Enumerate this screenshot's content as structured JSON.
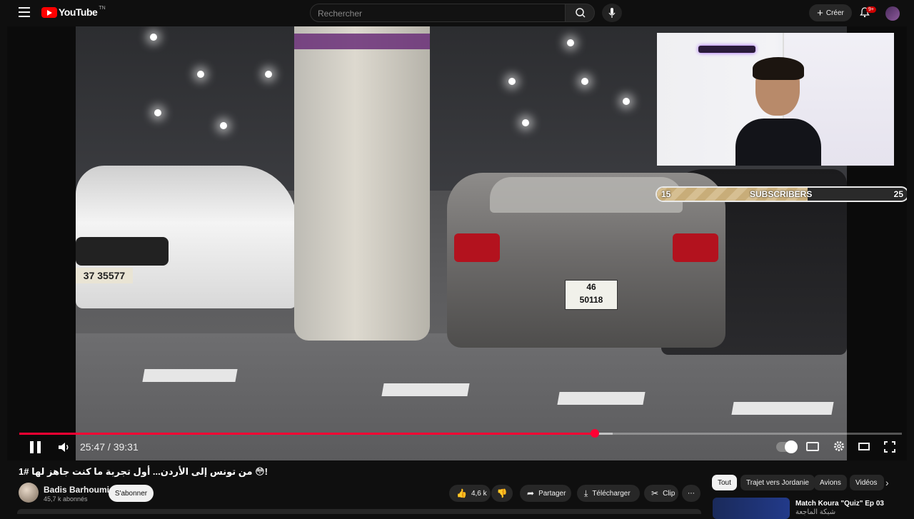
{
  "header": {
    "logo_text": "YouTube",
    "logo_country": "TN",
    "search_placeholder": "Rechercher",
    "create_label": "Créer",
    "notifications_badge": "9+"
  },
  "player": {
    "current_time": "25:47",
    "duration": "39:31",
    "time_display": "25:47 / 39:31",
    "progress_played_fraction": 0.652,
    "progress_loaded_fraction": 0.672,
    "overlay": {
      "subscribers_current": "15",
      "subscribers_label": "SUBSCRIBERS",
      "subscribers_goal": "25",
      "goal_fill_fraction": 0.6
    },
    "scene": {
      "plate_white": "37 35577",
      "plate_grey_top": "46",
      "plate_grey_bottom": "50118"
    }
  },
  "video": {
    "title": "من تونس إلى الأردن... أول تجربة ما كنت جاهز لها #1 😳!",
    "channel_name": "Badis Barhoumi",
    "channel_subscribers": "45,7 k abonnés",
    "subscribe_label": "S'abonner",
    "likes": "4,6 k",
    "share_label": "Partager",
    "download_label": "Télécharger",
    "clip_label": "Clip",
    "more_label": "⋯"
  },
  "chips": [
    "Tout",
    "Trajet vers Jordanie",
    "Avions",
    "Vidéos"
  ],
  "recommendation": {
    "title": "Match Koura \"Quiz\" Ep 03",
    "subtitle": "شبكة الماجعة"
  },
  "colors": {
    "accent_red": "#ff0033",
    "background": "#0f0f0f",
    "pill_background": "#272727"
  }
}
